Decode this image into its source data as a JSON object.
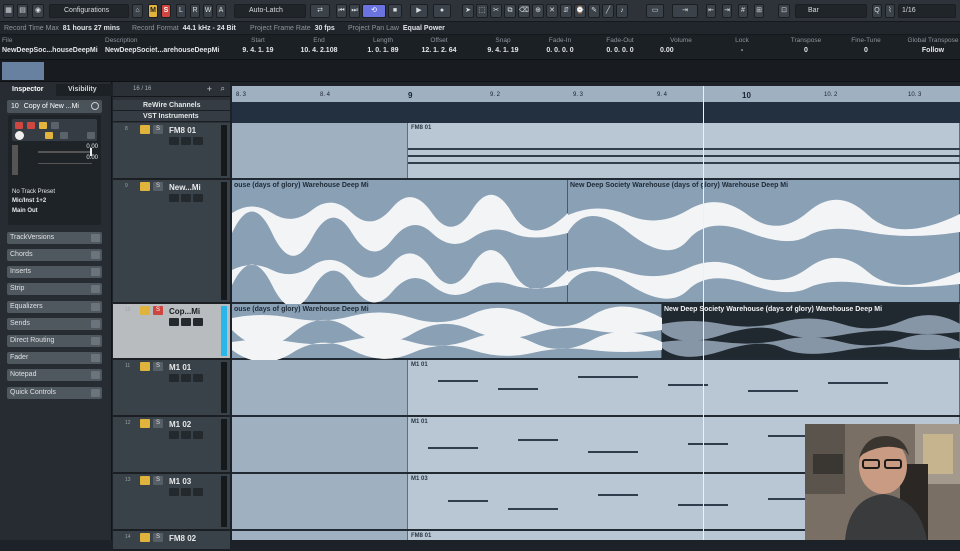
{
  "toolbar": {
    "configurations": "Configurations",
    "m": "M",
    "s": "S",
    "l": "L",
    "r": "R",
    "w": "W",
    "a": "A",
    "automation_mode": "Auto-Latch",
    "snap_type": "Bar",
    "quantize": "1/16"
  },
  "status": {
    "record_time_label": "Record Time Max",
    "record_time_value": "81 hours 27 mins",
    "record_format_label": "Record Format",
    "record_format_value": "44.1 kHz - 24 Bit",
    "frame_rate_label": "Project Frame Rate",
    "frame_rate_value": "30 fps",
    "pan_law_label": "Project Pan Law",
    "pan_law_value": "Equal Power"
  },
  "infoline": [
    {
      "h": "File",
      "v": "NewDeepSoc...houseDeepMi"
    },
    {
      "h": "Description",
      "v": "NewDeepSociet...arehouseDeepMi"
    },
    {
      "h": "Start",
      "v": "9. 4. 1. 19"
    },
    {
      "h": "End",
      "v": "10. 4. 2.108"
    },
    {
      "h": "Length",
      "v": "1. 0. 1. 89"
    },
    {
      "h": "Offset",
      "v": "12. 1. 2. 64"
    },
    {
      "h": "Snap",
      "v": "9. 4. 1. 19"
    },
    {
      "h": "Fade-In",
      "v": "0. 0. 0. 0"
    },
    {
      "h": "Fade-Out",
      "v": "0. 0. 0. 0"
    },
    {
      "h": "Volume",
      "v": "0.00"
    },
    {
      "h": "Lock",
      "v": "-"
    },
    {
      "h": "Transpose",
      "v": "0"
    },
    {
      "h": "Fine-Tune",
      "v": "0"
    },
    {
      "h": "Global Transpose",
      "v": "Follow"
    }
  ],
  "inspector": {
    "tab_inspector": "Inspector",
    "tab_visibility": "Visibility",
    "track_number": "10",
    "track_name": "Copy of New ...Mi",
    "volume": "0.00",
    "pan": "0.00",
    "preset": "No Track Preset",
    "input": "Mic/Inst 1+2",
    "output": "Main Out",
    "sections": [
      "TrackVersions",
      "Chords",
      "Inserts",
      "Strip",
      "Equalizers",
      "Sends",
      "Direct Routing",
      "Fader",
      "Notepad",
      "Quick Controls"
    ]
  },
  "tracklist": {
    "count": "16 / 16",
    "folders": [
      "ReWire Channels",
      "VST Instruments"
    ],
    "tracks": [
      {
        "num": "8",
        "name": "FM8 01"
      },
      {
        "num": "9",
        "name": "New...Mi"
      },
      {
        "num": "10",
        "name": "Cop...Mi"
      },
      {
        "num": "11",
        "name": "M1 01"
      },
      {
        "num": "12",
        "name": "M1 02"
      },
      {
        "num": "13",
        "name": "M1 03"
      },
      {
        "num": "14",
        "name": "FM8 02"
      }
    ]
  },
  "ruler": {
    "labels": [
      "8. 3",
      "8. 4",
      "9",
      "9. 2",
      "9. 3",
      "9. 4",
      "10",
      "10. 2",
      "10. 3"
    ]
  },
  "events": {
    "fm8_part": "FM8 01",
    "audio_left": "ouse (days of glory) Warehouse Deep Mi",
    "audio_right": "New Deep Society Warehouse (days of glory) Warehouse Deep Mi",
    "copy_left": "ouse (days of glory) Warehouse Deep Mi",
    "copy_selected": "New Deep Society Warehouse (days of glory) Warehouse Deep Mi",
    "m1_01": "M1 01",
    "m1_02": "M1 01",
    "m1_03": "M1 03",
    "fm8_02": "FM8 01"
  },
  "colors": {
    "mute": "#e2b43b",
    "solo": "#d0463f",
    "cycle": "#6a73e0",
    "audio_event": "#8aa0b5",
    "midi_part": "#b9c6d3"
  }
}
